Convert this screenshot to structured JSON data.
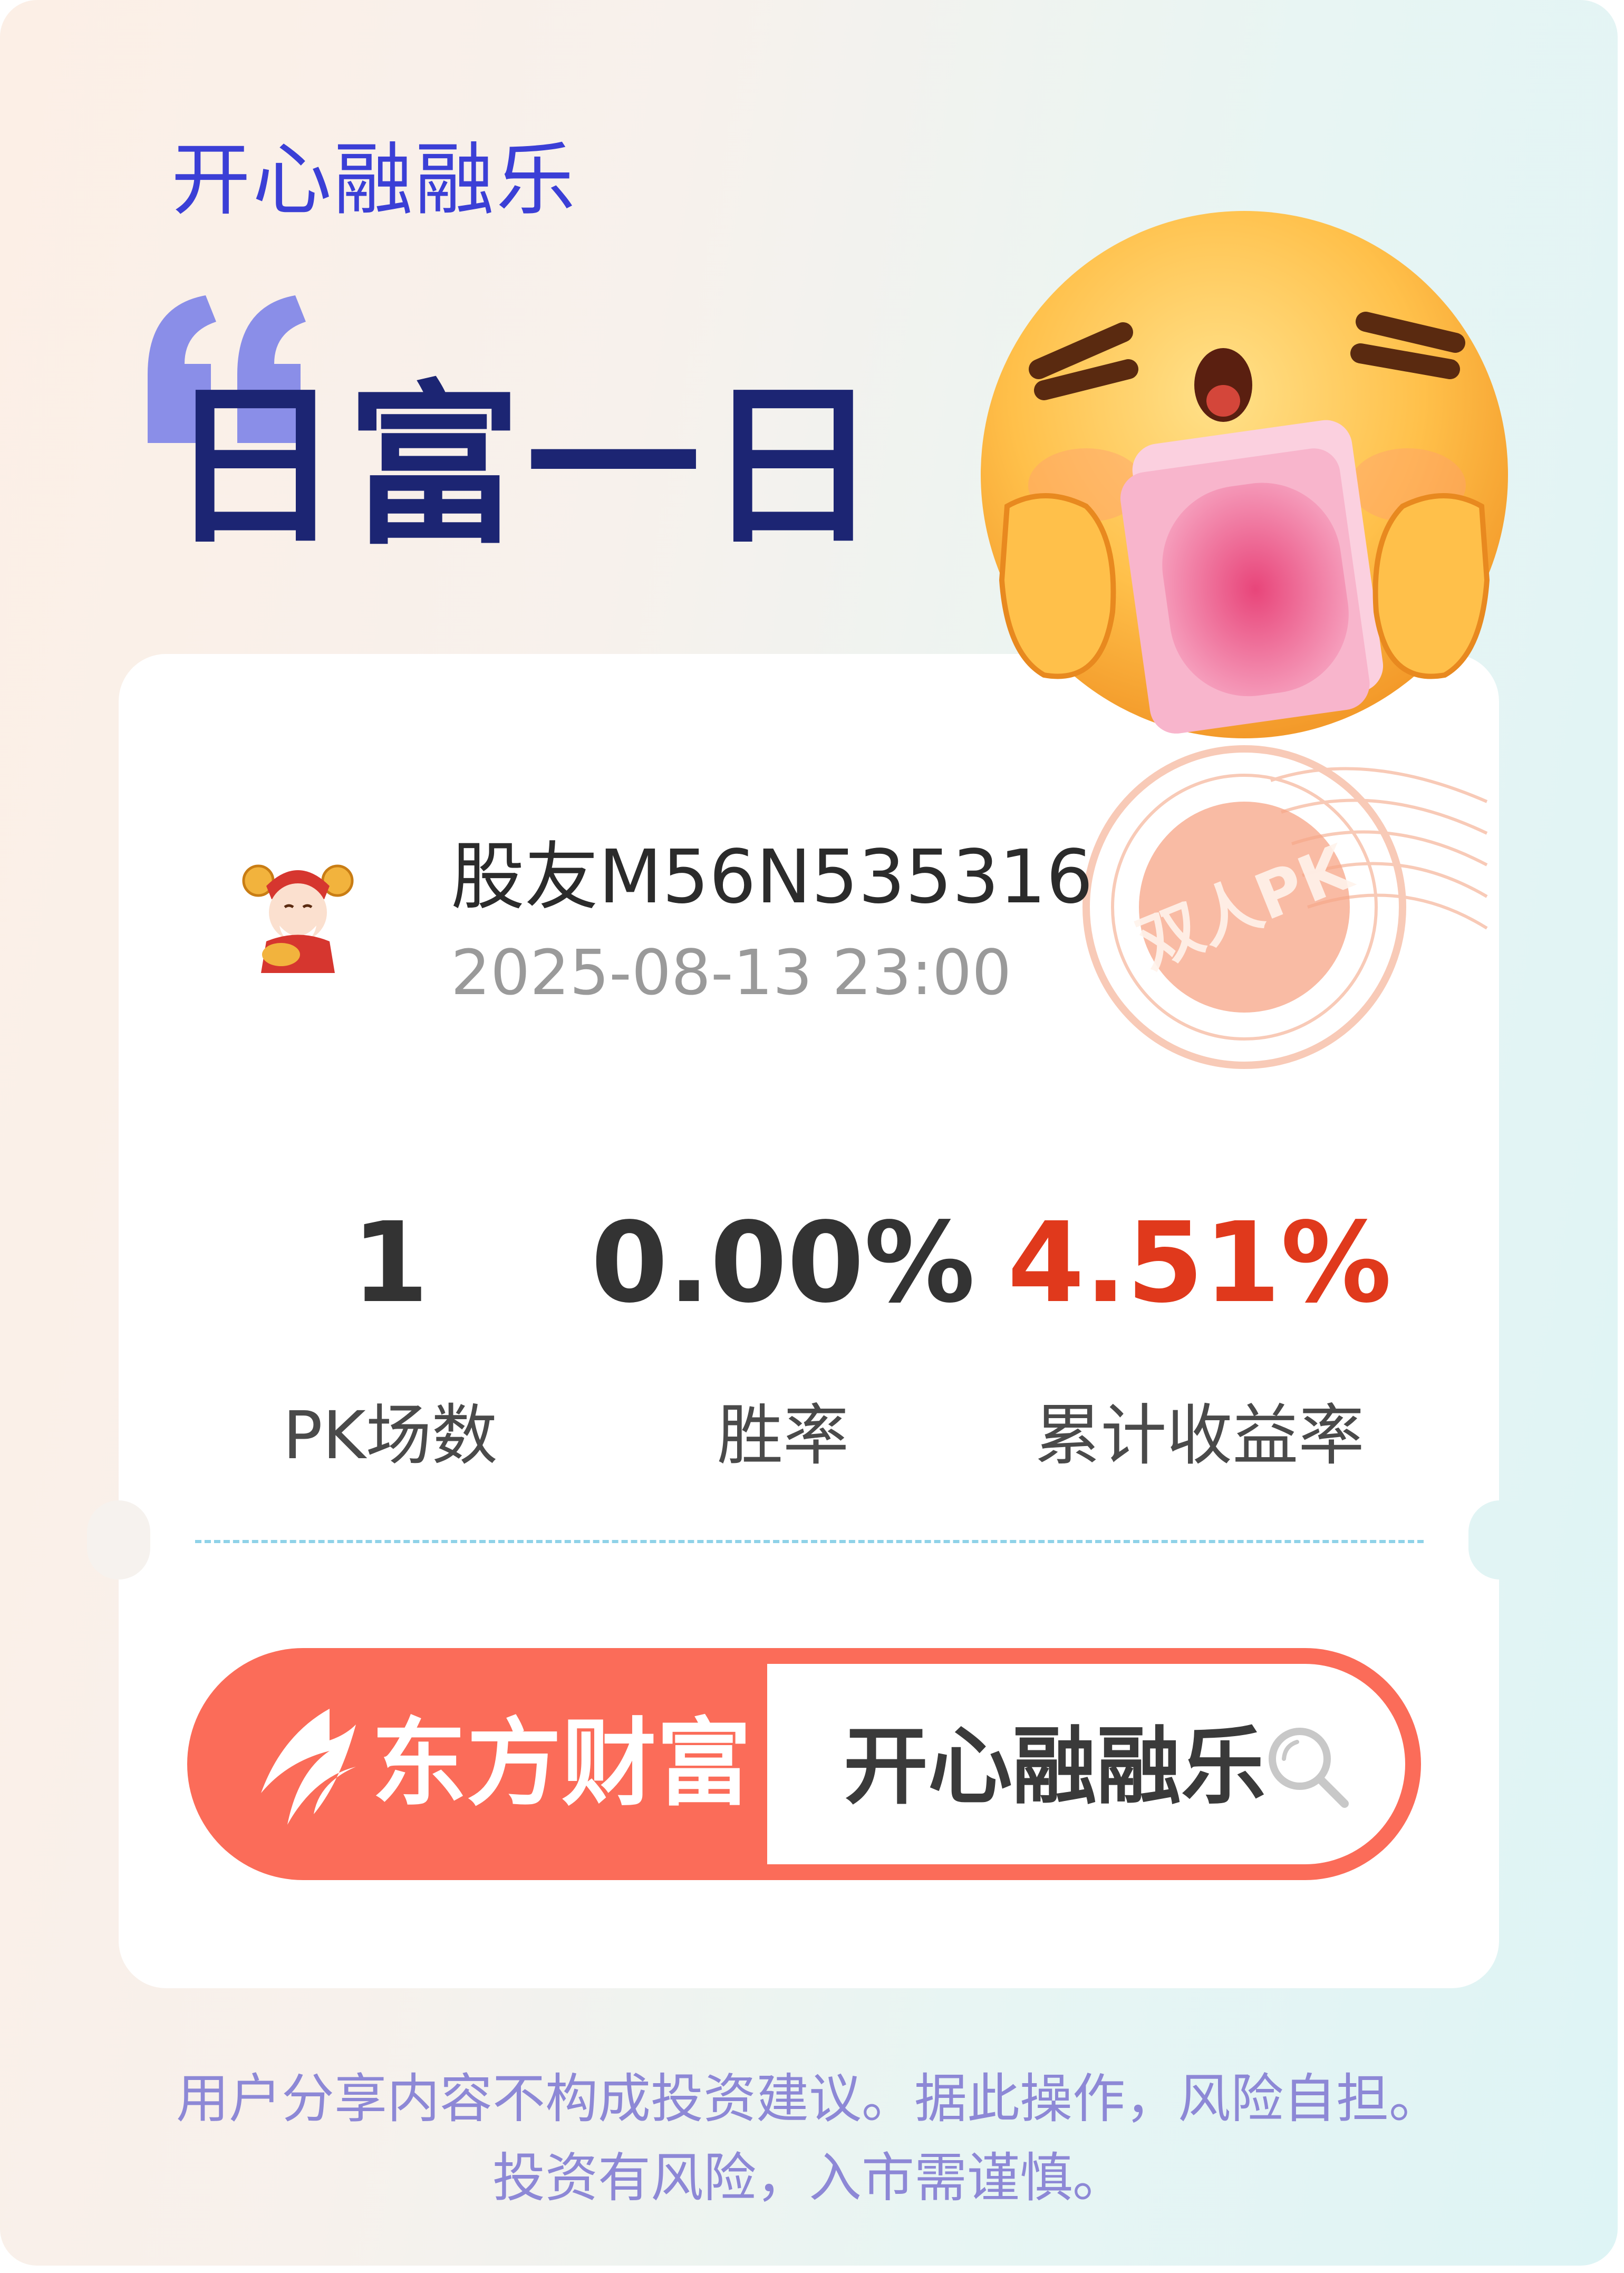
{
  "brand": {
    "title": "开心融融乐"
  },
  "headline": "日富一日",
  "stamp": {
    "text": "双人PK"
  },
  "user": {
    "name": "股友M56N535316",
    "datetime": "2025-08-13 23:00"
  },
  "stats": [
    {
      "value": "1",
      "label": "PK场数",
      "color": "#333333"
    },
    {
      "value": "0.00%",
      "label": "胜率",
      "color": "#333333"
    },
    {
      "value": "4.51%",
      "label": "累计收益率",
      "color": "#e0391c"
    }
  ],
  "search": {
    "brand_label": "东方财富",
    "query": "开心融融乐"
  },
  "disclaimer": {
    "line1": "用户分享内容不构成投资建议。据此操作，风险自担。",
    "line2": "投资有风险，入市需谨慎。"
  },
  "colors": {
    "brand_blue": "#3b3fd6",
    "headline_navy": "#1c2573",
    "accent_red": "#fb6c59",
    "gain_red": "#e0391c"
  }
}
